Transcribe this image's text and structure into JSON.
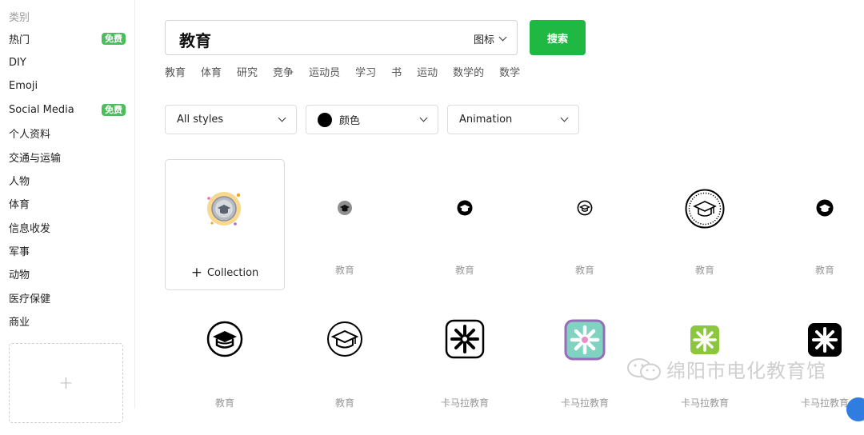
{
  "sidebar": {
    "heading": "类别",
    "items": [
      {
        "label": "热门",
        "badge": "免费"
      },
      {
        "label": "DIY"
      },
      {
        "label": "Emoji"
      },
      {
        "label": "Social Media",
        "badge": "免费"
      },
      {
        "label": "个人资料"
      },
      {
        "label": "交通与运输"
      },
      {
        "label": "人物"
      },
      {
        "label": "体育"
      },
      {
        "label": "信息收发"
      },
      {
        "label": "军事"
      },
      {
        "label": "动物"
      },
      {
        "label": "医疗保健"
      },
      {
        "label": "商业"
      }
    ],
    "upload_plus": "+"
  },
  "search": {
    "query": "教育",
    "type_label": "图标",
    "button_label": "搜索"
  },
  "related_terms": [
    "教育",
    "体育",
    "研究",
    "竞争",
    "运动员",
    "学习",
    "书",
    "运动",
    "数学的",
    "数学"
  ],
  "filters": {
    "style": "All styles",
    "color": "颜色",
    "animation": "Animation"
  },
  "collection_label": "Collection",
  "results": [
    {
      "label": "",
      "icon": "animated-graduation-cap-icon"
    },
    {
      "label": "教育",
      "icon": "graduation-cap-gray-circle-icon"
    },
    {
      "label": "教育",
      "icon": "graduation-cap-black-circle-icon"
    },
    {
      "label": "教育",
      "icon": "graduation-cap-outline-icon"
    },
    {
      "label": "教育",
      "icon": "graduation-cap-dotted-badge-icon"
    },
    {
      "label": "教育",
      "icon": "graduation-cap-black-circle-icon"
    },
    {
      "label": "教育",
      "icon": "graduation-cap-large-outline-icon"
    },
    {
      "label": "教育",
      "icon": "graduation-cap-large-thin-icon"
    },
    {
      "label": "卡马拉教育",
      "icon": "kamara-black-white-icon"
    },
    {
      "label": "卡马拉教育",
      "icon": "kamara-teal-pink-icon"
    },
    {
      "label": "卡马拉教育",
      "icon": "kamara-green-icon"
    },
    {
      "label": "卡马拉教育",
      "icon": "kamara-black-icon"
    }
  ],
  "watermark": "绵阳市电化教育馆",
  "colors": {
    "accent": "#1fb843",
    "badge": "#4cbc5c",
    "kamara_teal": "#7fd3c0",
    "kamara_green": "#8cc63e"
  }
}
